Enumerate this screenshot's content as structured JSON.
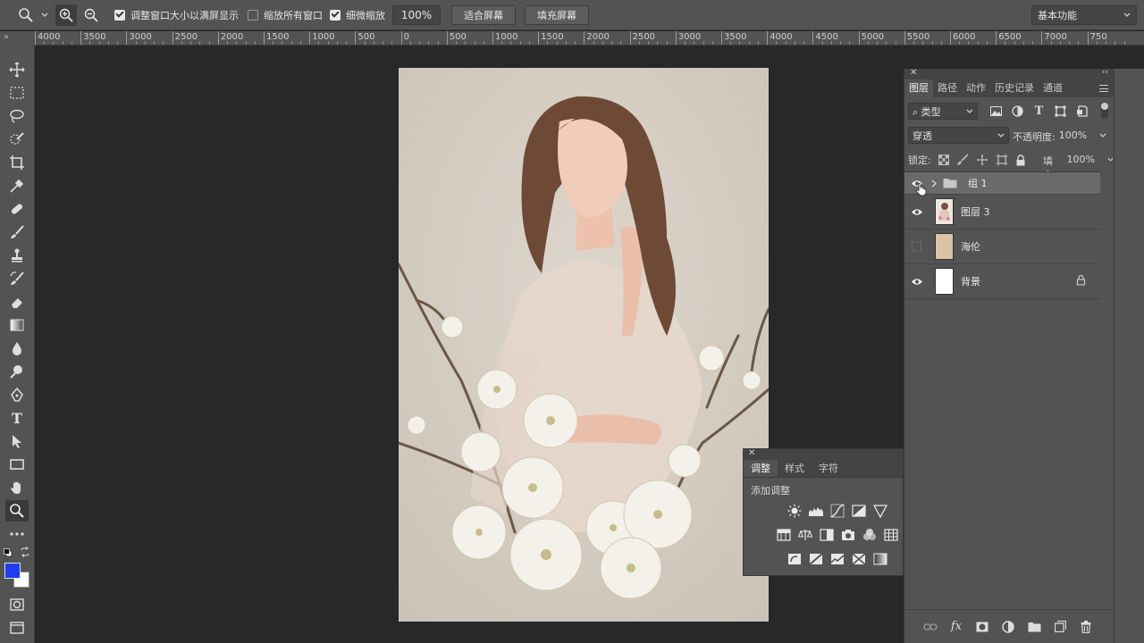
{
  "options_bar": {
    "resize_window_label": "调整窗口大小以满屏显示",
    "zoom_all_label": "缩放所有窗口",
    "scrubby_zoom_label": "细微缩放",
    "zoom_value": "100%",
    "fit_screen_label": "适合屏幕",
    "fill_screen_label": "填充屏幕",
    "workspace": "基本功能"
  },
  "ruler": {
    "corner": "»",
    "labels": [
      "4000",
      "3500",
      "3000",
      "2500",
      "2000",
      "1500",
      "1000",
      "500",
      "0",
      "500",
      "1000",
      "1500",
      "2000",
      "2500",
      "3000",
      "3500",
      "4000",
      "4500",
      "5000",
      "5500",
      "6000",
      "6500",
      "7000",
      "750"
    ]
  },
  "adjustments_panel": {
    "tabs": [
      "调整",
      "样式",
      "字符"
    ],
    "title": "添加调整"
  },
  "layers_panel": {
    "tabs": [
      "图层",
      "路径",
      "动作",
      "历史记录",
      "通道"
    ],
    "filter": "类型",
    "blend_mode": "穿透",
    "opacity_label": "不透明度:",
    "opacity_value": "100%",
    "lock_label": "锁定:",
    "fill_label": "填充:",
    "fill_value": "100%",
    "layers": [
      {
        "name": "组 1",
        "visible": true
      },
      {
        "name": "图层 3",
        "visible": true
      },
      {
        "name": "海伦",
        "visible": false
      },
      {
        "name": "背景",
        "visible": true
      }
    ]
  },
  "colors": {
    "foreground": "#1f3cf0",
    "background": "#ffffff",
    "swatch_layer": "#dcc3a6"
  }
}
